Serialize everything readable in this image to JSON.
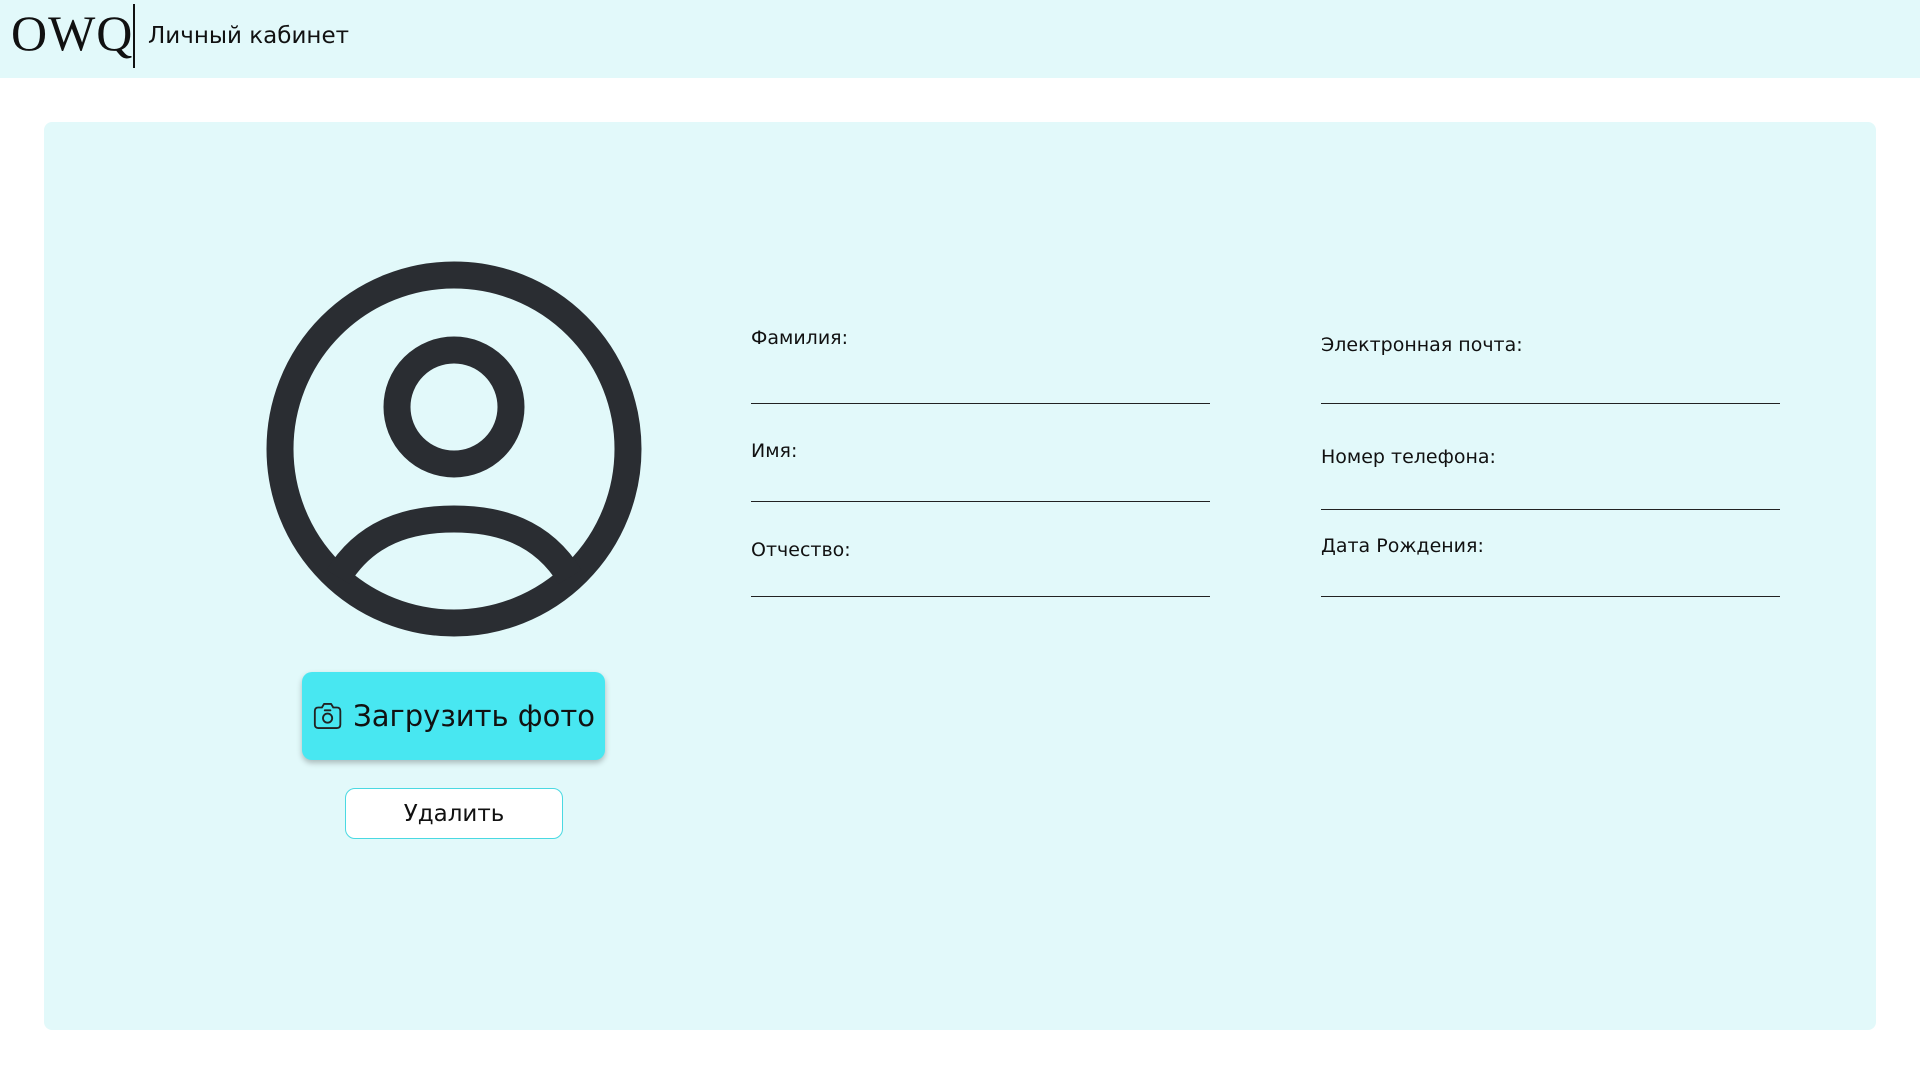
{
  "header": {
    "logo": "OWQ",
    "title": "Личный кабинет"
  },
  "profile": {
    "avatar_icon": "user-circle-icon",
    "upload_icon": "camera-icon",
    "upload_label": "Загрузить фото",
    "delete_label": "Удалить"
  },
  "form": {
    "left": {
      "surname": {
        "label": "Фамилия:",
        "value": ""
      },
      "name": {
        "label": "Имя:",
        "value": ""
      },
      "patronymic": {
        "label": "Отчество:",
        "value": ""
      }
    },
    "right": {
      "email": {
        "label": "Электронная почта:",
        "value": ""
      },
      "phone": {
        "label": "Номер телефона:",
        "value": ""
      },
      "birthdate": {
        "label": "Дата Рождения:",
        "value": ""
      }
    }
  },
  "colors": {
    "panel_bg": "#e2f9fa",
    "accent": "#48e7f1",
    "icon": "#2a2d32"
  }
}
